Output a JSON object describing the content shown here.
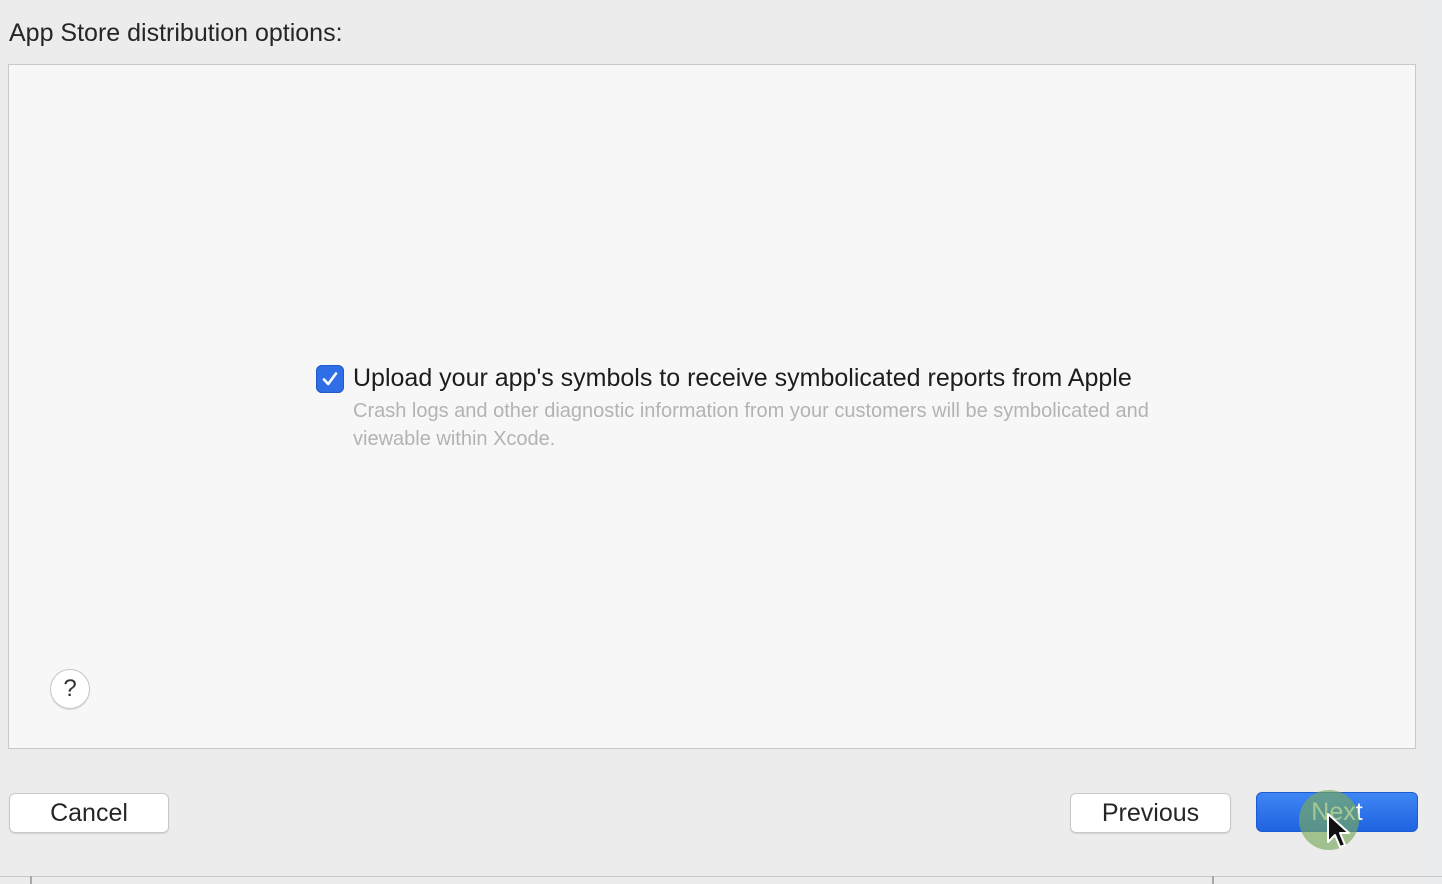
{
  "header": {
    "title": "App Store distribution options:"
  },
  "options": [
    {
      "checked": true,
      "label": "Upload your app's symbols to receive symbolicated reports from Apple",
      "description": "Crash logs and other diagnostic information from your customers will be symbolicated and viewable within Xcode."
    }
  ],
  "help": {
    "label": "?"
  },
  "buttons": {
    "cancel": "Cancel",
    "previous": "Previous",
    "next": "Next"
  },
  "colors": {
    "accent": "#2f6ee6",
    "click_highlight": "#78aa5a"
  },
  "icons": {
    "checkbox": "checkmark-icon",
    "cursor": "mouse-pointer-icon"
  }
}
